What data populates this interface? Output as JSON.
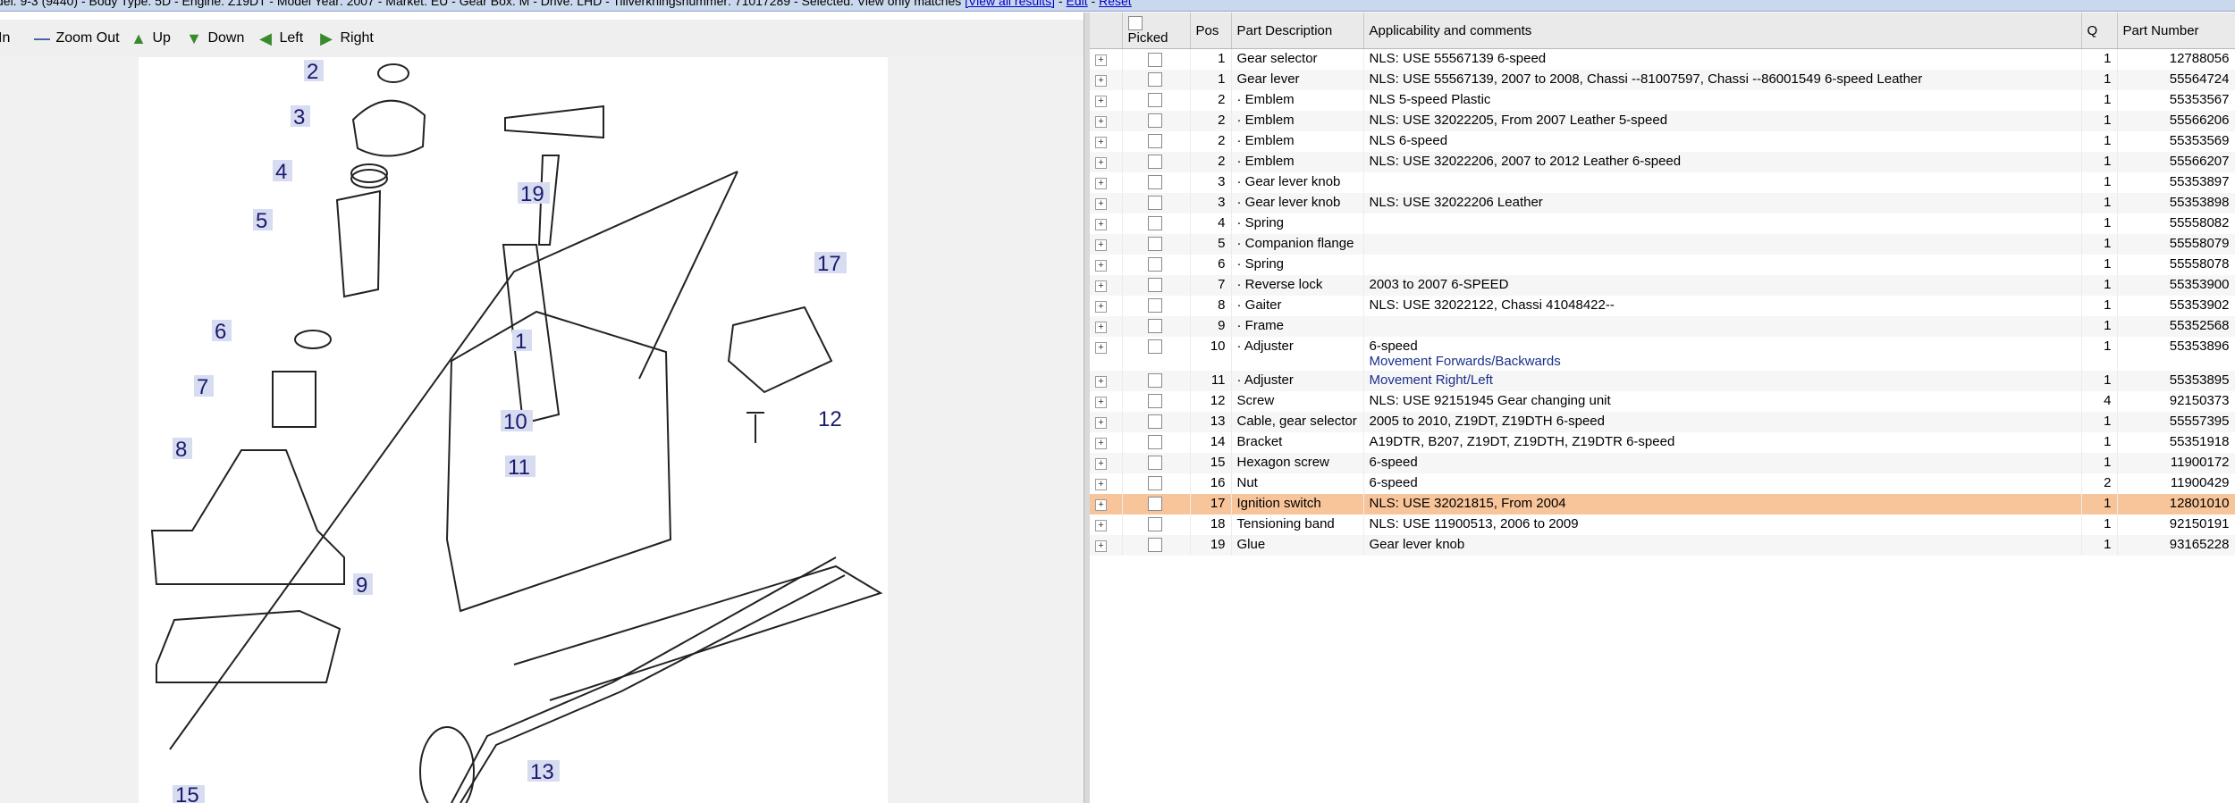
{
  "topbar": {
    "info": "del. 9-3 (9440) - Body Type: 5D - Engine: Z19DT - Model Year: 2007 - Market: EU - Gear Box: M - Drive: LHD - Tillverkningsnummer: 71017289 - Selected: View only matches",
    "link_all": "[View all results]",
    "sep1": " - ",
    "link_edit": "Edit",
    "sep2": " - ",
    "link_reset": "Reset"
  },
  "toolbar": {
    "zoom_in": "In",
    "zoom_out": "Zoom Out",
    "up": "Up",
    "down": "Down",
    "left": "Left",
    "right": "Right"
  },
  "diagram": {
    "callouts": [
      "2",
      "3",
      "4",
      "5",
      "6",
      "7",
      "8",
      "9",
      "10",
      "11",
      "12",
      "13",
      "15",
      "17",
      "19",
      "1"
    ]
  },
  "parts_table": {
    "columns": [
      "Picked",
      "Pos",
      "Part Description",
      "Applicability and comments",
      "Q",
      "Part Number"
    ],
    "rows": [
      {
        "pos": "1",
        "desc": "Gear selector",
        "comment": "NLS: USE 55567139 6-speed",
        "sub": "",
        "q": "1",
        "part": "12788056"
      },
      {
        "pos": "1",
        "desc": "Gear lever",
        "comment": "NLS: USE 55567139, 2007 to 2008, Chassi --81007597, Chassi --86001549 6-speed Leather",
        "sub": "",
        "q": "1",
        "part": "55564724"
      },
      {
        "pos": "2",
        "desc": "· Emblem",
        "comment": "NLS 5-speed Plastic",
        "sub": "",
        "q": "1",
        "part": "55353567"
      },
      {
        "pos": "2",
        "desc": "· Emblem",
        "comment": "NLS: USE 32022205, From 2007 Leather 5-speed",
        "sub": "",
        "q": "1",
        "part": "55566206"
      },
      {
        "pos": "2",
        "desc": "· Emblem",
        "comment": "NLS 6-speed",
        "sub": "",
        "q": "1",
        "part": "55353569"
      },
      {
        "pos": "2",
        "desc": "· Emblem",
        "comment": "NLS: USE 32022206, 2007 to 2012 Leather 6-speed",
        "sub": "",
        "q": "1",
        "part": "55566207"
      },
      {
        "pos": "3",
        "desc": "· Gear lever knob",
        "comment": "",
        "sub": "",
        "q": "1",
        "part": "55353897"
      },
      {
        "pos": "3",
        "desc": "· Gear lever knob",
        "comment": "NLS: USE 32022206 Leather",
        "sub": "",
        "q": "1",
        "part": "55353898"
      },
      {
        "pos": "4",
        "desc": "· Spring",
        "comment": "",
        "sub": "",
        "q": "1",
        "part": "55558082"
      },
      {
        "pos": "5",
        "desc": "· Companion flange",
        "comment": "",
        "sub": "",
        "q": "1",
        "part": "55558079"
      },
      {
        "pos": "6",
        "desc": "· Spring",
        "comment": "",
        "sub": "",
        "q": "1",
        "part": "55558078"
      },
      {
        "pos": "7",
        "desc": "· Reverse lock",
        "comment": "2003 to 2007 6-SPEED",
        "sub": "",
        "q": "1",
        "part": "55353900"
      },
      {
        "pos": "8",
        "desc": "· Gaiter",
        "comment": "NLS: USE 32022122, Chassi 41048422--",
        "sub": "",
        "q": "1",
        "part": "55353902"
      },
      {
        "pos": "9",
        "desc": "· Frame",
        "comment": "",
        "sub": "",
        "q": "1",
        "part": "55352568"
      },
      {
        "pos": "10",
        "desc": "· Adjuster",
        "comment": "6-speed",
        "sub": "Movement Forwards/Backwards",
        "q": "1",
        "part": "55353896"
      },
      {
        "pos": "11",
        "desc": "· Adjuster",
        "comment": "",
        "sub": "Movement Right/Left",
        "q": "1",
        "part": "55353895"
      },
      {
        "pos": "12",
        "desc": "Screw",
        "comment": "NLS: USE 92151945 Gear changing unit",
        "sub": "",
        "q": "4",
        "part": "92150373"
      },
      {
        "pos": "13",
        "desc": "Cable, gear selector",
        "comment": "2005 to 2010, Z19DT, Z19DTH 6-speed",
        "sub": "",
        "q": "1",
        "part": "55557395"
      },
      {
        "pos": "14",
        "desc": "Bracket",
        "comment": "A19DTR, B207, Z19DT, Z19DTH, Z19DTR 6-speed",
        "sub": "",
        "q": "1",
        "part": "55351918"
      },
      {
        "pos": "15",
        "desc": "Hexagon screw",
        "comment": "6-speed",
        "sub": "",
        "q": "1",
        "part": "11900172"
      },
      {
        "pos": "16",
        "desc": "Nut",
        "comment": "6-speed",
        "sub": "",
        "q": "2",
        "part": "11900429"
      },
      {
        "pos": "17",
        "desc": "Ignition switch",
        "comment": "NLS: USE 32021815, From 2004",
        "sub": "",
        "q": "1",
        "part": "12801010",
        "selected": true
      },
      {
        "pos": "18",
        "desc": "Tensioning band",
        "comment": "NLS: USE 11900513, 2006 to 2009",
        "sub": "",
        "q": "1",
        "part": "92150191"
      },
      {
        "pos": "19",
        "desc": "Glue",
        "comment": "Gear lever knob",
        "sub": "",
        "q": "1",
        "part": "93165228"
      }
    ]
  },
  "colors": {
    "selected_row": "#f8c49a",
    "link": "#0000cc",
    "callout_bg": "#d7dcf0"
  }
}
